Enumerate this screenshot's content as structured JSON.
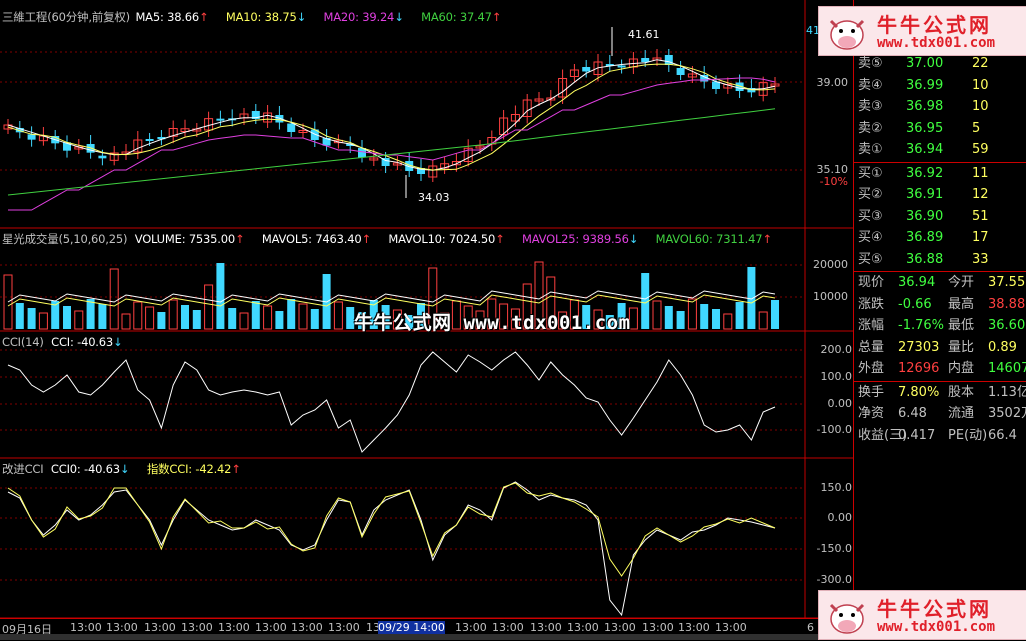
{
  "colors": {
    "up": "#ff4040",
    "down": "#40d8ff",
    "ma5": "#ffffff",
    "ma10": "#ffff60",
    "ma20": "#e040e0",
    "ma60": "#40d040",
    "grid": "#800000",
    "axis": "#c00000"
  },
  "price_panel": {
    "title": "三維工程(60分钟,前复权)",
    "ma5": "MA5: 38.66",
    "ma10": "MA10: 38.75",
    "ma20": "MA20: 39.24",
    "ma60": "MA60: 37.47",
    "high_label": "41.61",
    "low_label": "34.03",
    "axis": [
      "39.00",
      "35.10",
      "-10%"
    ],
    "axis_top": "41"
  },
  "volume_panel": {
    "indicator": "星光成交量(5,10,60,25)",
    "volume": "VOLUME: 7535.00",
    "mavol5": "MAVOL5: 7463.40",
    "mavol10": "MAVOL10: 7024.50",
    "mavol25": "MAVOL25: 9389.56",
    "mavol60": "MAVOL60: 7311.47",
    "axis": [
      "20000",
      "10000"
    ]
  },
  "cci_panel": {
    "indicator": "CCI(14)",
    "value": "CCI: -40.63",
    "axis": [
      "200.0",
      "100.0",
      "0.00",
      "-100.0"
    ]
  },
  "cci2_panel": {
    "indicator": "改进CCI",
    "value1": "CCI0: -40.63",
    "value2": "指数CCI: -42.42",
    "axis": [
      "150.0",
      "0.00",
      "-150.0",
      "-300.0"
    ]
  },
  "watermark": "牛牛公式网 www.tdx001.com",
  "logo": {
    "title": "牛牛公式网",
    "url": "www.tdx001.com"
  },
  "time_axis": [
    "09月16日",
    "13:00",
    "13:00",
    "13:00",
    "13:00",
    "13:00",
    "13:00",
    "13:00",
    "13:00",
    "13:00",
    "13:00",
    "09/29 14:00",
    "13:00",
    "13:00",
    "13:00",
    "13:00",
    "13:00",
    "13:00",
    "13:00",
    "13:00",
    "6"
  ],
  "order_book": [
    {
      "label": "卖⑤",
      "price": "37.00",
      "vol": "22"
    },
    {
      "label": "卖④",
      "price": "36.99",
      "vol": "10"
    },
    {
      "label": "卖③",
      "price": "36.98",
      "vol": "10"
    },
    {
      "label": "卖②",
      "price": "36.95",
      "vol": "5"
    },
    {
      "label": "卖①",
      "price": "36.94",
      "vol": "59"
    },
    {
      "label": "买①",
      "price": "36.92",
      "vol": "11"
    },
    {
      "label": "买②",
      "price": "36.91",
      "vol": "12"
    },
    {
      "label": "买③",
      "price": "36.90",
      "vol": "51"
    },
    {
      "label": "买④",
      "price": "36.89",
      "vol": "17"
    },
    {
      "label": "买⑤",
      "price": "36.88",
      "vol": "33"
    }
  ],
  "stats": [
    {
      "l1": "现价",
      "v1": "36.94",
      "l2": "今开",
      "v2": "37.55"
    },
    {
      "l1": "涨跌",
      "v1": "-0.66",
      "l2": "最高",
      "v2": "38.88"
    },
    {
      "l1": "涨幅",
      "v1": "-1.76%",
      "l2": "最低",
      "v2": "36.60"
    },
    {
      "l1": "总量",
      "v1": "27303",
      "l2": "量比",
      "v2": "0.89"
    },
    {
      "l1": "外盘",
      "v1": "12696",
      "l2": "内盘",
      "v2": "14607"
    },
    {
      "l1": "换手",
      "v1": "7.80%",
      "l2": "股本",
      "v2": "1.13亿"
    },
    {
      "l1": "净资",
      "v1": "6.48",
      "l2": "流通",
      "v2": "3502万"
    },
    {
      "l1": "收益(三)",
      "v1": "0.417",
      "l2": "PE(动)",
      "v2": "66.4"
    }
  ]
}
